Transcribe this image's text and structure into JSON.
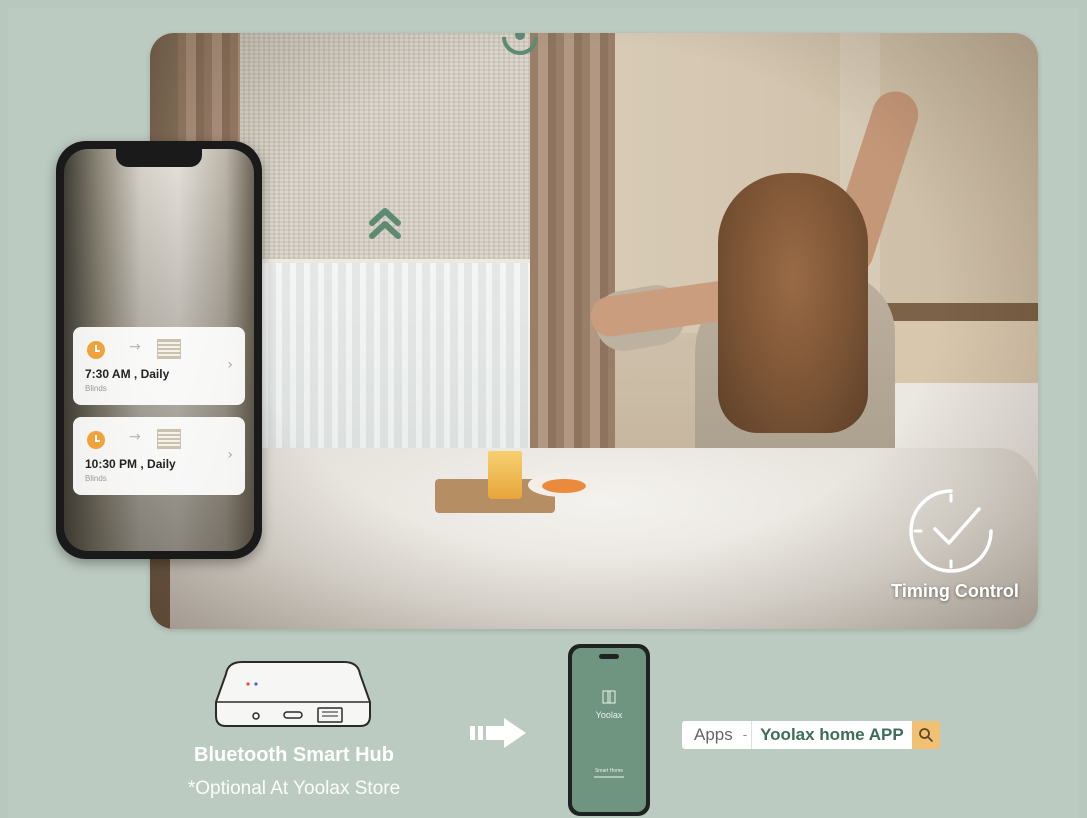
{
  "scene": {
    "timing_label": "Timing Control",
    "icons": [
      "blind-up-icon",
      "target-icon",
      "timer-icon"
    ]
  },
  "schedule": {
    "items": [
      {
        "time": "7:30 AM , Daily",
        "device": "Blinds"
      },
      {
        "time": "10:30 PM , Daily",
        "device": "Blinds"
      }
    ]
  },
  "hub": {
    "title": "Bluetooth Smart Hub",
    "subtitle": "*Optional At Yoolax Store"
  },
  "app": {
    "name": "Yoolax",
    "tagline": "Smart Home"
  },
  "search": {
    "category": "Apps",
    "separator": "-",
    "query": "Yoolax home APP"
  },
  "colors": {
    "background": "#bccbc1",
    "accent_green": "#3e6d58",
    "search_button": "#f2c073",
    "clock_orange": "#f0a23b"
  }
}
